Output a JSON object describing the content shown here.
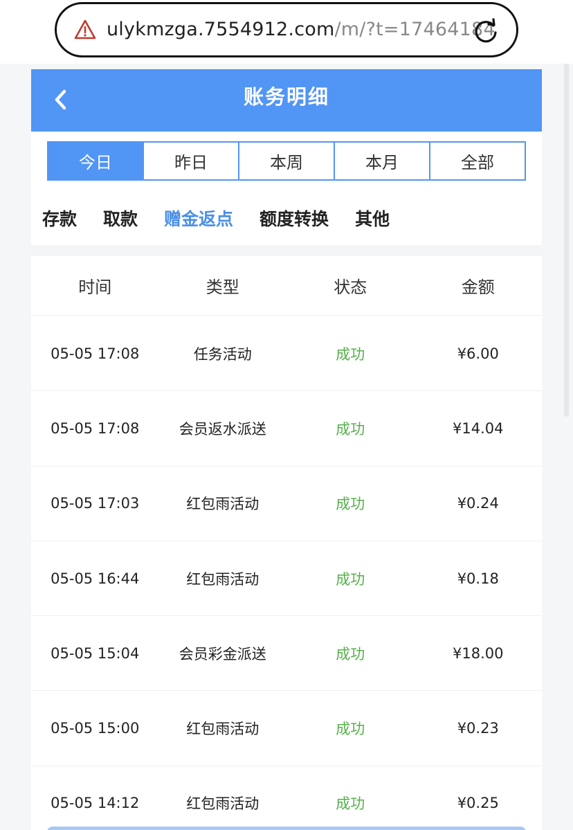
{
  "browser": {
    "url_host": "ulykmzga.7554912.com",
    "url_path": "/m/?t=17464184",
    "warning_icon": "warning-triangle-icon",
    "reload_icon": "reload-icon"
  },
  "header": {
    "title": "账务明细",
    "back_icon": "chevron-left-icon",
    "bg_color": "#5195f5"
  },
  "date_tabs": [
    "今日",
    "昨日",
    "本周",
    "本月",
    "全部"
  ],
  "date_tab_selected": "今日",
  "type_tabs": [
    "存款",
    "取款",
    "赠金返点",
    "额度转换",
    "其他"
  ],
  "type_tab_selected": "赠金返点",
  "table": {
    "headers": [
      "时间",
      "类型",
      "状态",
      "金额"
    ],
    "rows": [
      {
        "time": "05-05 17:08",
        "type": "任务活动",
        "status": "成功",
        "amount": "¥6.00"
      },
      {
        "time": "05-05 17:08",
        "type": "会员返水派送",
        "status": "成功",
        "amount": "¥14.04"
      },
      {
        "time": "05-05 17:03",
        "type": "红包雨活动",
        "status": "成功",
        "amount": "¥0.24"
      },
      {
        "time": "05-05 16:44",
        "type": "红包雨活动",
        "status": "成功",
        "amount": "¥0.18"
      },
      {
        "time": "05-05 15:04",
        "type": "会员彩金派送",
        "status": "成功",
        "amount": "¥18.00"
      },
      {
        "time": "05-05 15:00",
        "type": "红包雨活动",
        "status": "成功",
        "amount": "¥0.23"
      },
      {
        "time": "05-05 14:12",
        "type": "红包雨活动",
        "status": "成功",
        "amount": "¥0.25"
      }
    ]
  },
  "colors": {
    "accent": "#5195f5",
    "active_tab_text": "#4a8fe8",
    "success": "#55b04a"
  }
}
